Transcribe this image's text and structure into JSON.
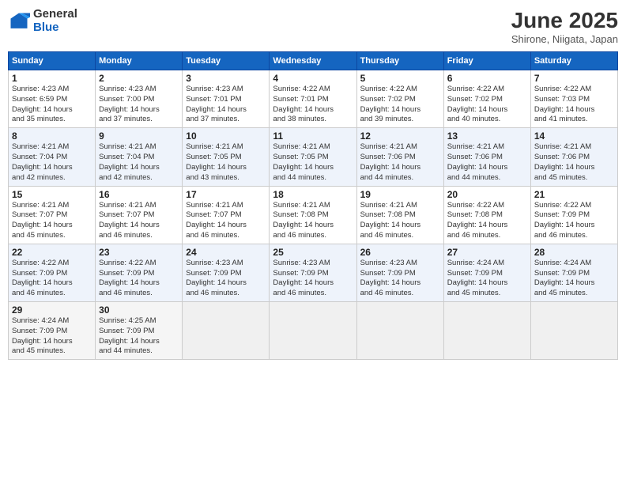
{
  "logo": {
    "general": "General",
    "blue": "Blue"
  },
  "title": "June 2025",
  "location": "Shirone, Niigata, Japan",
  "days_of_week": [
    "Sunday",
    "Monday",
    "Tuesday",
    "Wednesday",
    "Thursday",
    "Friday",
    "Saturday"
  ],
  "weeks": [
    [
      {
        "day": "1",
        "sunrise": "4:23 AM",
        "sunset": "6:59 PM",
        "daylight": "14 hours and 35 minutes."
      },
      {
        "day": "2",
        "sunrise": "4:23 AM",
        "sunset": "7:00 PM",
        "daylight": "14 hours and 37 minutes."
      },
      {
        "day": "3",
        "sunrise": "4:23 AM",
        "sunset": "7:01 PM",
        "daylight": "14 hours and 37 minutes."
      },
      {
        "day": "4",
        "sunrise": "4:22 AM",
        "sunset": "7:01 PM",
        "daylight": "14 hours and 38 minutes."
      },
      {
        "day": "5",
        "sunrise": "4:22 AM",
        "sunset": "7:02 PM",
        "daylight": "14 hours and 39 minutes."
      },
      {
        "day": "6",
        "sunrise": "4:22 AM",
        "sunset": "7:02 PM",
        "daylight": "14 hours and 40 minutes."
      },
      {
        "day": "7",
        "sunrise": "4:22 AM",
        "sunset": "7:03 PM",
        "daylight": "14 hours and 41 minutes."
      }
    ],
    [
      {
        "day": "8",
        "sunrise": "4:21 AM",
        "sunset": "7:04 PM",
        "daylight": "14 hours and 42 minutes."
      },
      {
        "day": "9",
        "sunrise": "4:21 AM",
        "sunset": "7:04 PM",
        "daylight": "14 hours and 42 minutes."
      },
      {
        "day": "10",
        "sunrise": "4:21 AM",
        "sunset": "7:05 PM",
        "daylight": "14 hours and 43 minutes."
      },
      {
        "day": "11",
        "sunrise": "4:21 AM",
        "sunset": "7:05 PM",
        "daylight": "14 hours and 44 minutes."
      },
      {
        "day": "12",
        "sunrise": "4:21 AM",
        "sunset": "7:06 PM",
        "daylight": "14 hours and 44 minutes."
      },
      {
        "day": "13",
        "sunrise": "4:21 AM",
        "sunset": "7:06 PM",
        "daylight": "14 hours and 44 minutes."
      },
      {
        "day": "14",
        "sunrise": "4:21 AM",
        "sunset": "7:06 PM",
        "daylight": "14 hours and 45 minutes."
      }
    ],
    [
      {
        "day": "15",
        "sunrise": "4:21 AM",
        "sunset": "7:07 PM",
        "daylight": "14 hours and 45 minutes."
      },
      {
        "day": "16",
        "sunrise": "4:21 AM",
        "sunset": "7:07 PM",
        "daylight": "14 hours and 46 minutes."
      },
      {
        "day": "17",
        "sunrise": "4:21 AM",
        "sunset": "7:07 PM",
        "daylight": "14 hours and 46 minutes."
      },
      {
        "day": "18",
        "sunrise": "4:21 AM",
        "sunset": "7:08 PM",
        "daylight": "14 hours and 46 minutes."
      },
      {
        "day": "19",
        "sunrise": "4:21 AM",
        "sunset": "7:08 PM",
        "daylight": "14 hours and 46 minutes."
      },
      {
        "day": "20",
        "sunrise": "4:22 AM",
        "sunset": "7:08 PM",
        "daylight": "14 hours and 46 minutes."
      },
      {
        "day": "21",
        "sunrise": "4:22 AM",
        "sunset": "7:09 PM",
        "daylight": "14 hours and 46 minutes."
      }
    ],
    [
      {
        "day": "22",
        "sunrise": "4:22 AM",
        "sunset": "7:09 PM",
        "daylight": "14 hours and 46 minutes."
      },
      {
        "day": "23",
        "sunrise": "4:22 AM",
        "sunset": "7:09 PM",
        "daylight": "14 hours and 46 minutes."
      },
      {
        "day": "24",
        "sunrise": "4:23 AM",
        "sunset": "7:09 PM",
        "daylight": "14 hours and 46 minutes."
      },
      {
        "day": "25",
        "sunrise": "4:23 AM",
        "sunset": "7:09 PM",
        "daylight": "14 hours and 46 minutes."
      },
      {
        "day": "26",
        "sunrise": "4:23 AM",
        "sunset": "7:09 PM",
        "daylight": "14 hours and 46 minutes."
      },
      {
        "day": "27",
        "sunrise": "4:24 AM",
        "sunset": "7:09 PM",
        "daylight": "14 hours and 45 minutes."
      },
      {
        "day": "28",
        "sunrise": "4:24 AM",
        "sunset": "7:09 PM",
        "daylight": "14 hours and 45 minutes."
      }
    ],
    [
      {
        "day": "29",
        "sunrise": "4:24 AM",
        "sunset": "7:09 PM",
        "daylight": "14 hours and 45 minutes."
      },
      {
        "day": "30",
        "sunrise": "4:25 AM",
        "sunset": "7:09 PM",
        "daylight": "14 hours and 44 minutes."
      },
      null,
      null,
      null,
      null,
      null
    ]
  ]
}
